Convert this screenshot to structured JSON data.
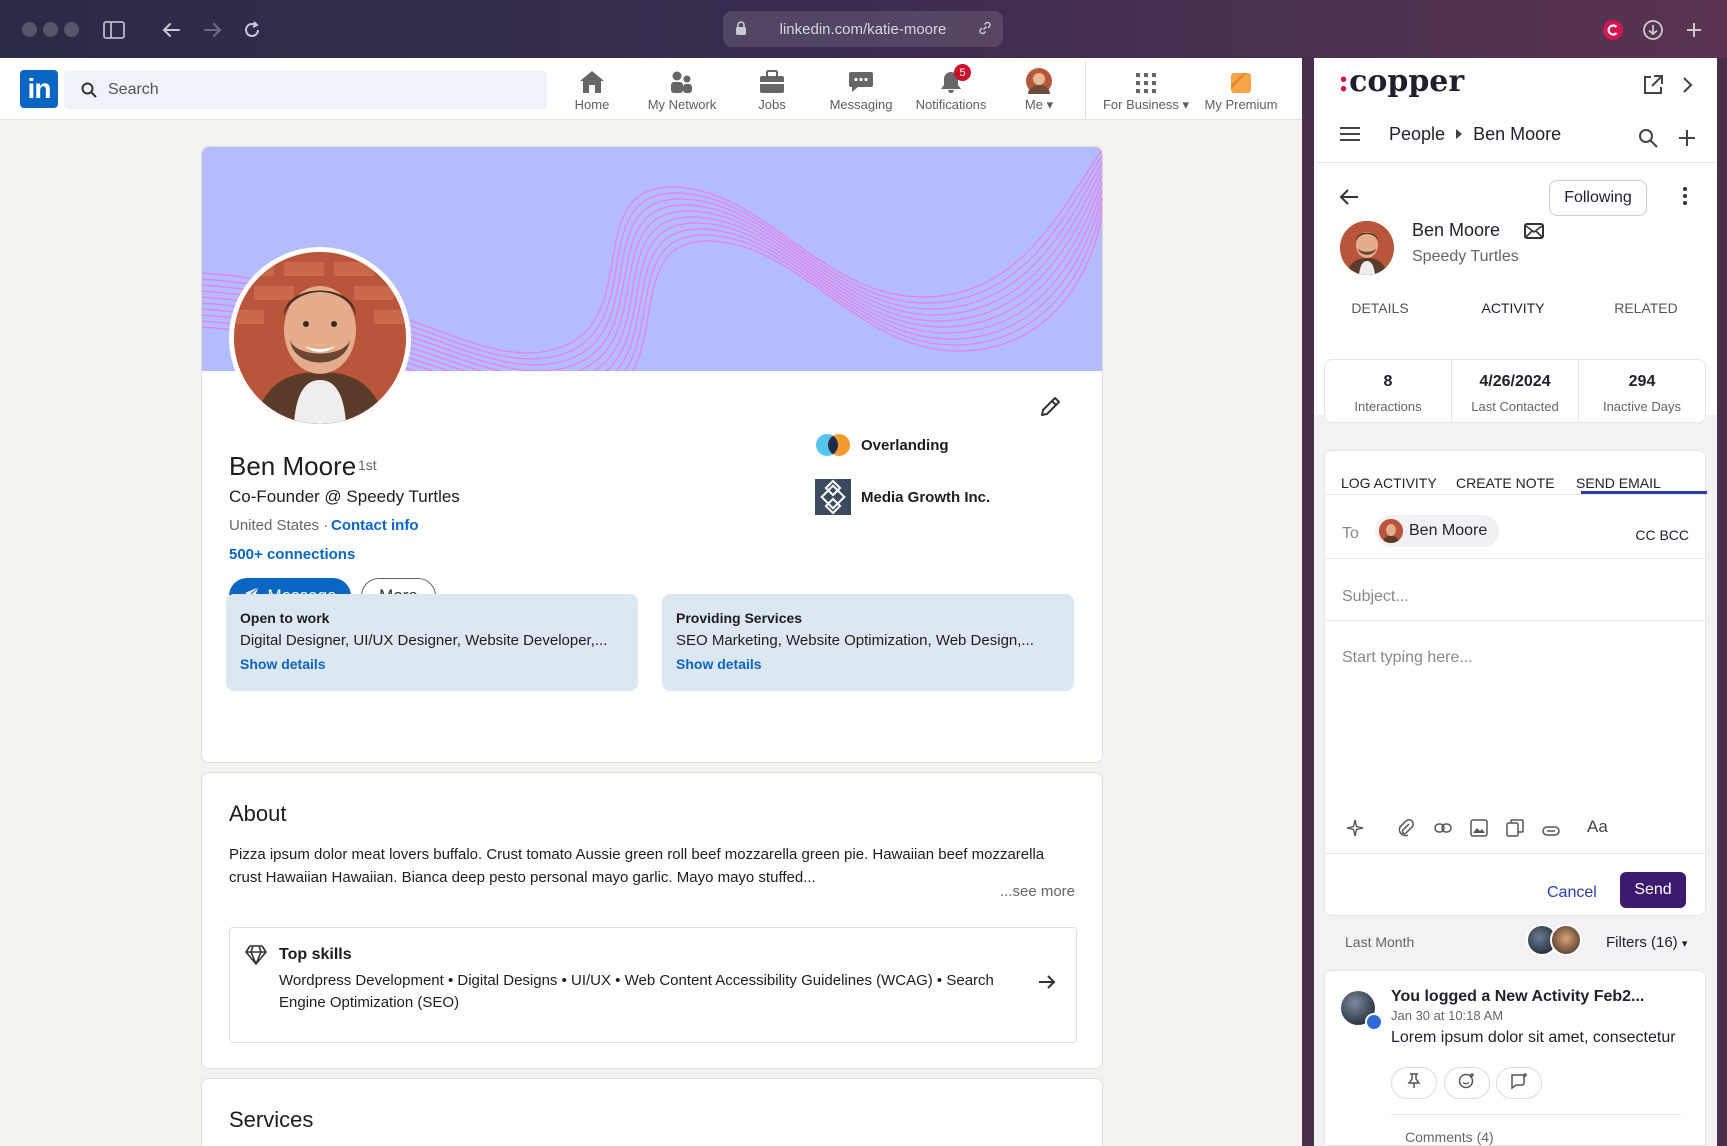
{
  "browser": {
    "url": "linkedin.com/katie-moore"
  },
  "linkedin": {
    "search_placeholder": "Search",
    "nav": [
      {
        "label": "Home"
      },
      {
        "label": "My Network"
      },
      {
        "label": "Jobs"
      },
      {
        "label": "Messaging"
      },
      {
        "label": "Notifications",
        "badge": "5"
      },
      {
        "label": "Me"
      },
      {
        "label": "For Business"
      },
      {
        "label": "My Premium"
      }
    ],
    "profile": {
      "name": "Ben Moore",
      "degree": "1st",
      "headline": "Co-Founder @ Speedy Turtles",
      "location": "United States",
      "separator": "·",
      "contact_info": "Contact info",
      "connections": "500+ connections",
      "message_label": "Message",
      "more_label": "More",
      "companies": [
        {
          "name": "Overlanding"
        },
        {
          "name": "Media Growth Inc."
        }
      ],
      "open_to_work": {
        "title": "Open to work",
        "desc": "Digital Designer, UI/UX Designer, Website Developer,...",
        "link": "Show details"
      },
      "providing_services": {
        "title": "Providing Services",
        "desc": "SEO Marketing, Website Optimization, Web Design,...",
        "link": "Show details"
      }
    },
    "about": {
      "title": "About",
      "text": "Pizza ipsum dolor meat lovers buffalo. Crust tomato Aussie green roll beef mozzarella green pie. Hawaiian beef mozzarella crust Hawaiian Hawaiian. Bianca deep pesto personal mayo garlic. Mayo mayo stuffed...",
      "see_more": "...see more",
      "top_skills_title": "Top skills",
      "top_skills": "Wordpress Development • Digital Designs • UI/UX • Web Content Accessibility Guidelines (WCAG) • Search Engine Optimization (SEO)"
    },
    "services": {
      "title": "Services"
    }
  },
  "copper": {
    "logo": "copper",
    "breadcrumb": {
      "root": "People",
      "current": "Ben Moore"
    },
    "following_label": "Following",
    "person": {
      "name": "Ben Moore",
      "company": "Speedy Turtles"
    },
    "tabs": [
      "DETAILS",
      "ACTIVITY",
      "RELATED"
    ],
    "active_tab": "ACTIVITY",
    "stats": [
      {
        "value": "8",
        "label": "Interactions"
      },
      {
        "value": "4/26/2024",
        "label": "Last Contacted"
      },
      {
        "value": "294",
        "label": "Inactive Days"
      }
    ],
    "composer": {
      "tabs": [
        "LOG ACTIVITY",
        "CREATE NOTE",
        "SEND EMAIL"
      ],
      "active_tab": "SEND EMAIL",
      "to_label": "To",
      "to_name": "Ben Moore",
      "cc_bcc": "CC  BCC",
      "subject_placeholder": "Subject...",
      "body_placeholder": "Start typing here...",
      "font_label": "Aa",
      "cancel_label": "Cancel",
      "send_label": "Send"
    },
    "feed": {
      "period": "Last Month",
      "filters_label": "Filters (16)",
      "item": {
        "title": "You logged a New Activity Feb2...",
        "time": "Jan 30 at 10:18 AM",
        "text": "Lorem ipsum dolor sit amet, consectetur",
        "comments": "Comments (4)"
      }
    },
    "colors": {
      "accent": "#2e3ca8",
      "send": "#3c1a6e",
      "brand_dot": "#d5164e"
    }
  }
}
